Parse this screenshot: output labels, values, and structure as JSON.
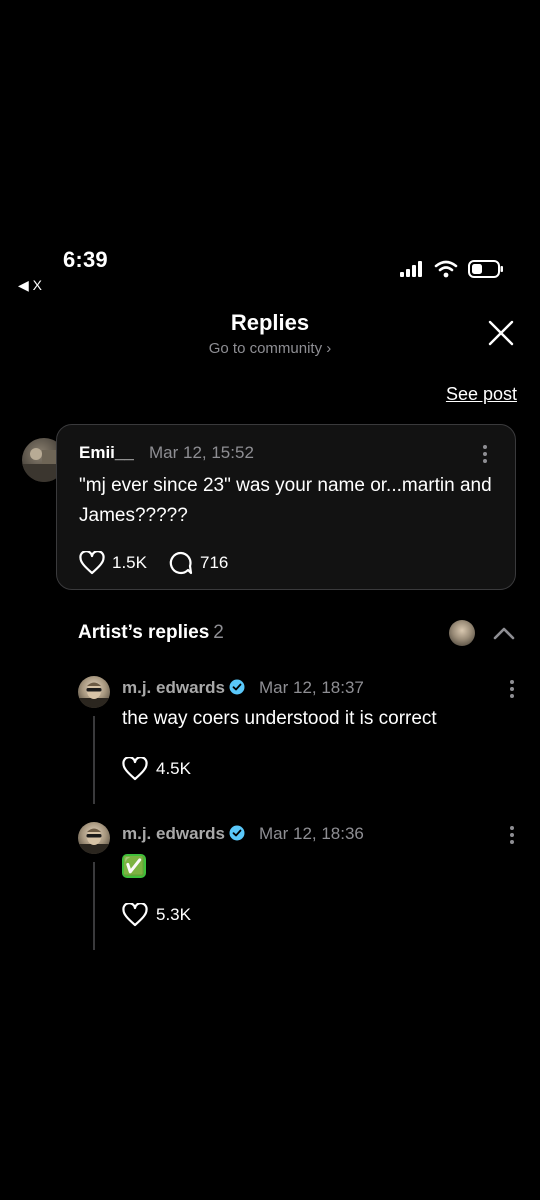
{
  "status_bar": {
    "time": "6:39",
    "back_label": "X"
  },
  "header": {
    "title": "Replies",
    "subtitle": "Go to community"
  },
  "see_post_label": "See post",
  "post": {
    "author": "Emii__",
    "time": "Mar 12, 15:52",
    "text": "\"mj ever since 23\" was your name or...martin and James?????",
    "likes": "1.5K",
    "comments": "716"
  },
  "artist_replies": {
    "title": "Artist’s replies",
    "count": "2",
    "items": [
      {
        "author": "m.j. edwards",
        "time": "Mar 12, 18:37",
        "text": "the way coers understood it is correct",
        "likes": "4.5K"
      },
      {
        "author": "m.j. edwards",
        "time": "Mar 12, 18:36",
        "text": "✅",
        "likes": "5.3K"
      }
    ]
  },
  "icons": {
    "heart": "heart-icon",
    "comment": "comment-icon",
    "close": "close-icon",
    "verified": "verified-icon",
    "more": "more-icon",
    "chevron_up": "chevron-up-icon"
  },
  "colors": {
    "background": "#000000",
    "muted": "#8e8e93",
    "verified": "#5ac8fa",
    "card_border": "#3a3a3c"
  }
}
